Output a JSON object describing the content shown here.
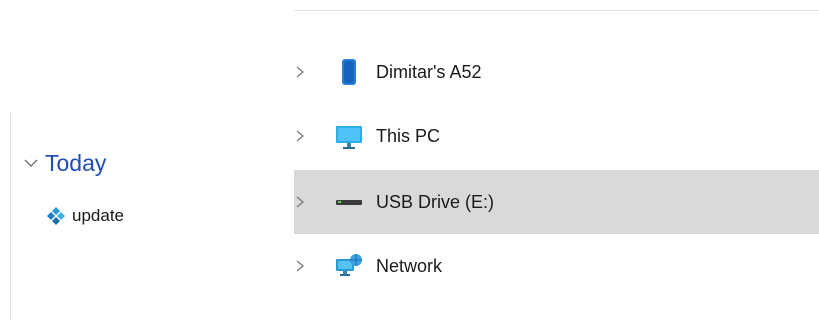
{
  "left_pane": {
    "group": {
      "title": "Today",
      "icon": "chevron-down-icon"
    },
    "files": [
      {
        "label": "update",
        "icon": "kodi-icon"
      }
    ]
  },
  "nav_tree": {
    "items": [
      {
        "label": "Dimitar's A52",
        "icon": "phone-icon",
        "selected": false
      },
      {
        "label": "This PC",
        "icon": "monitor-icon",
        "selected": false
      },
      {
        "label": "USB Drive (E:)",
        "icon": "usb-drive-icon",
        "selected": true
      },
      {
        "label": "Network",
        "icon": "network-icon",
        "selected": false
      }
    ]
  },
  "colors": {
    "accent": "#1f4fb5",
    "selected_row": "#d9d9d9",
    "divider": "#e3e3e3"
  }
}
